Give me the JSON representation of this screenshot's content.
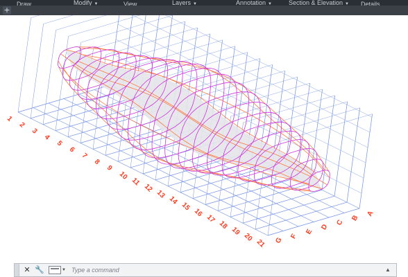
{
  "ribbon": {
    "panels": [
      {
        "label": "Draw",
        "has_menu": false
      },
      {
        "label": "Modify",
        "has_menu": true
      },
      {
        "label": "View",
        "has_menu": false
      },
      {
        "label": "Layers",
        "has_menu": true
      },
      {
        "label": "Annotation",
        "has_menu": true
      },
      {
        "label": "Section & Elevation",
        "has_menu": true
      },
      {
        "label": "Details",
        "has_menu": false
      }
    ]
  },
  "tabs": {
    "add_icon": "plus-icon"
  },
  "grid": {
    "number_labels": [
      "1",
      "2",
      "3",
      "4",
      "5",
      "6",
      "7",
      "8",
      "9",
      "10",
      "11",
      "12",
      "13",
      "14",
      "15",
      "16",
      "17",
      "18",
      "19",
      "20",
      "21"
    ],
    "letter_labels": [
      "A",
      "B",
      "C",
      "D",
      "E",
      "F",
      "G"
    ],
    "label_color": "#ff3b1f",
    "grid_line_color": "#6f8fe6"
  },
  "model": {
    "section_line_color": "#cc33dd",
    "longitudinal_line_color": "#ff6a2a",
    "surface_fill": "#e6e6ea"
  },
  "command_line": {
    "close_icon": "close-icon",
    "customize_icon": "wrench-icon",
    "recent_icon": "recent-commands-icon",
    "placeholder": "Type a command"
  }
}
